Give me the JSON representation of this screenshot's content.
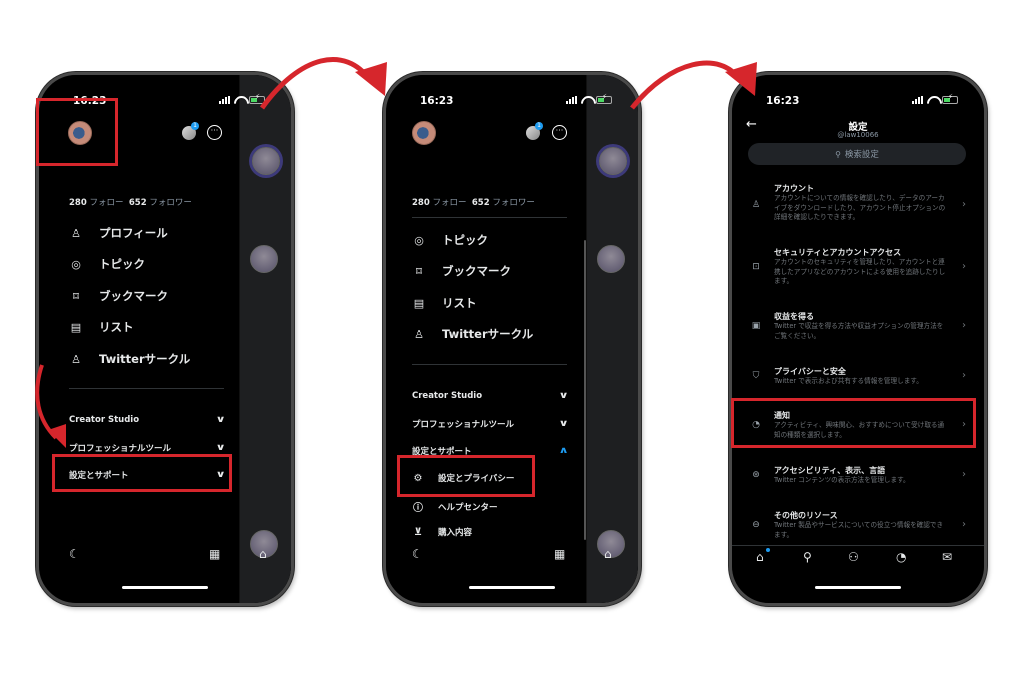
{
  "colors": {
    "highlight": "#d6262c",
    "accent": "#1d9bf0",
    "background": "#000000",
    "muted_text": "#8b98a5"
  },
  "phones": [
    {
      "status": {
        "time": "16:23"
      },
      "header": {
        "notification_badge": "1"
      },
      "follow": {
        "following_count": "280",
        "following_label": "フォロー",
        "followers_count": "652",
        "followers_label": "フォロワー"
      },
      "menu": [
        {
          "icon": "person-icon",
          "label": "プロフィール"
        },
        {
          "icon": "topic-icon",
          "label": "トピック"
        },
        {
          "icon": "bookmark-icon",
          "label": "ブックマーク"
        },
        {
          "icon": "list-icon",
          "label": "リスト"
        },
        {
          "icon": "twitter-circle-icon",
          "label": "Twitterサークル"
        }
      ],
      "sections": [
        {
          "label": "Creator Studio",
          "expanded": false
        },
        {
          "label": "プロフェッショナルツール",
          "expanded": false
        },
        {
          "label": "設定とサポート",
          "expanded": false
        }
      ]
    },
    {
      "status": {
        "time": "16:23"
      },
      "header": {
        "notification_badge": "1"
      },
      "follow": {
        "following_count": "280",
        "following_label": "フォロー",
        "followers_count": "652",
        "followers_label": "フォロワー"
      },
      "menu": [
        {
          "icon": "topic-icon",
          "label": "トピック"
        },
        {
          "icon": "bookmark-icon",
          "label": "ブックマーク"
        },
        {
          "icon": "list-icon",
          "label": "リスト"
        },
        {
          "icon": "twitter-circle-icon",
          "label": "Twitterサークル"
        }
      ],
      "sections": [
        {
          "label": "Creator Studio",
          "expanded": false
        },
        {
          "label": "プロフェッショナルツール",
          "expanded": false
        },
        {
          "label": "設定とサポート",
          "expanded": true
        }
      ],
      "sub_items": [
        {
          "icon": "gear-icon",
          "label": "設定とプライバシー"
        },
        {
          "icon": "help-icon",
          "label": "ヘルプセンター"
        },
        {
          "icon": "cart-icon",
          "label": "購入内容"
        }
      ]
    },
    {
      "status": {
        "time": "16:23"
      },
      "header": {
        "title": "設定",
        "handle": "@law10066"
      },
      "search": {
        "placeholder": "検索設定"
      },
      "settings": [
        {
          "icon": "person-icon",
          "title": "アカウント",
          "desc": "アカウントについての情報を確認したり、データのアーカイブをダウンロードしたり、アカウント停止オプションの詳細を確認したりできます。"
        },
        {
          "icon": "lock-icon",
          "title": "セキュリティとアカウントアクセス",
          "desc": "アカウントのセキュリティを管理したり、アカウントと連携したアプリなどのアカウントによる使用を追跡したりします。"
        },
        {
          "icon": "money-icon",
          "title": "収益を得る",
          "desc": "Twitter で収益を得る方法や収益オプションの管理方法をご覧ください。"
        },
        {
          "icon": "shield-icon",
          "title": "プライバシーと安全",
          "desc": "Twitter で表示および共有する情報を管理します。"
        },
        {
          "icon": "bell-icon",
          "title": "通知",
          "desc": "アクティビティ、興味関心、おすすめについて受け取る通知の種類を選択します。"
        },
        {
          "icon": "accessibility-icon",
          "title": "アクセシビリティ、表示、言語",
          "desc": "Twitter コンテンツの表示方法を管理します。"
        },
        {
          "icon": "more-icon",
          "title": "その他のリソース",
          "desc": "Twitter 製品やサービスについての役立つ情報を確認できます。"
        }
      ],
      "tabbar": [
        "home-icon",
        "search-icon",
        "communities-icon",
        "bell-icon",
        "mail-icon"
      ]
    }
  ]
}
